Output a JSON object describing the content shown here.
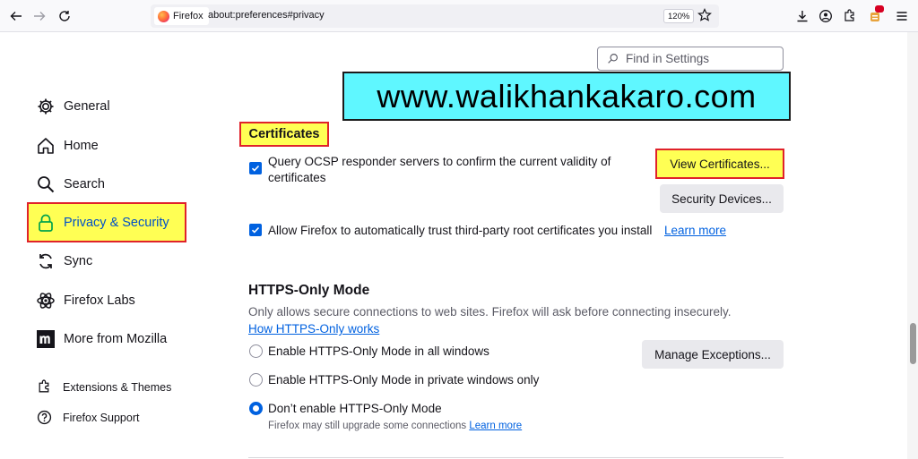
{
  "browser": {
    "identity_label": "Firefox",
    "url": "about:preferences#privacy",
    "zoom": "120%"
  },
  "search": {
    "placeholder": "Find in Settings"
  },
  "banner": {
    "text": "www.walikhankakaro.com"
  },
  "sidebar": {
    "items": [
      {
        "label": "General",
        "icon": "gear-icon"
      },
      {
        "label": "Home",
        "icon": "home-icon"
      },
      {
        "label": "Search",
        "icon": "search-icon"
      },
      {
        "label": "Privacy & Security",
        "icon": "lock-icon",
        "active": true
      },
      {
        "label": "Sync",
        "icon": "sync-icon"
      },
      {
        "label": "Firefox Labs",
        "icon": "labs-icon"
      },
      {
        "label": "More from Mozilla",
        "icon": "mozilla-icon"
      }
    ],
    "footer": [
      {
        "label": "Extensions & Themes",
        "icon": "puzzle-icon"
      },
      {
        "label": "Firefox Support",
        "icon": "help-icon"
      }
    ]
  },
  "certificates": {
    "title": "Certificates",
    "ocsp_line1": "Query OCSP responder servers to confirm the current validity of",
    "ocsp_line2": "certificates",
    "ocsp_checked": true,
    "view_button": "View Certificates...",
    "devices_button": "Security Devices...",
    "trust_label": "Allow Firefox to automatically trust third-party root certificates you install",
    "trust_checked": true,
    "learn_more": "Learn more"
  },
  "https_only": {
    "title": "HTTPS-Only Mode",
    "description": "Only allows secure connections to web sites. Firefox will ask before connecting insecurely.",
    "how_link": "How HTTPS-Only works",
    "manage_button": "Manage Exceptions...",
    "options": [
      {
        "label": "Enable HTTPS-Only Mode in all windows",
        "selected": false
      },
      {
        "label": "Enable HTTPS-Only Mode in private windows only",
        "selected": false
      },
      {
        "label": "Don’t enable HTTPS-Only Mode",
        "selected": true
      }
    ],
    "note": "Firefox may still upgrade some connections",
    "note_link": "Learn more"
  },
  "colors": {
    "accent": "#0061e0",
    "highlight": "#ffff54",
    "highlight_border": "#e0222a",
    "banner_bg": "#5ff7ff"
  }
}
